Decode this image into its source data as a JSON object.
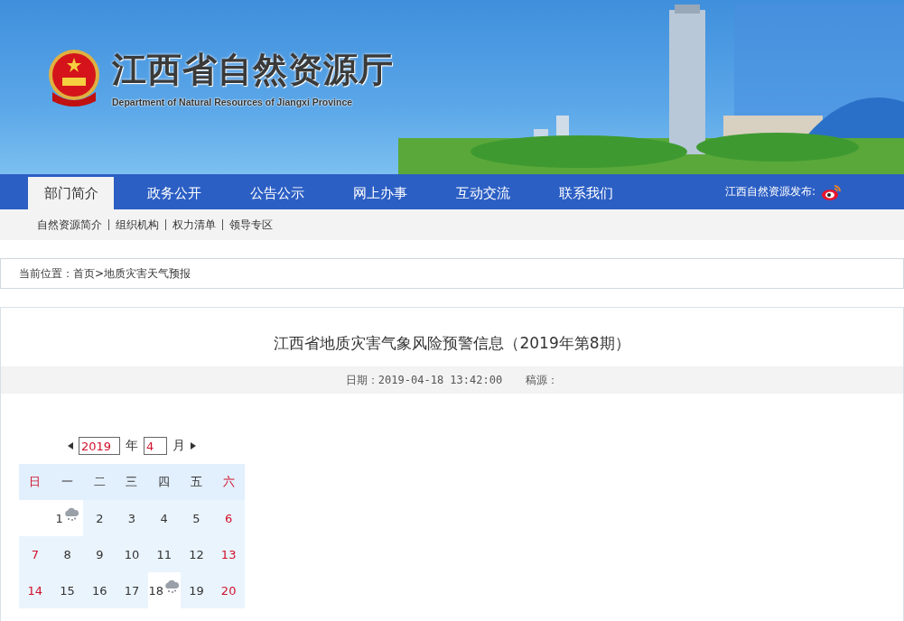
{
  "header": {
    "title": "江西省自然资源厅",
    "subtitle": "Department of Natural Resources of Jiangxi Province"
  },
  "nav": {
    "items": [
      {
        "label": "部门简介",
        "selected": true
      },
      {
        "label": "政务公开",
        "selected": false
      },
      {
        "label": "公告公示",
        "selected": false
      },
      {
        "label": "网上办事",
        "selected": false
      },
      {
        "label": "互动交流",
        "selected": false
      },
      {
        "label": "联系我们",
        "selected": false
      }
    ],
    "release_label": "江西自然资源发布:"
  },
  "subnav": [
    "自然资源简介",
    "组织机构",
    "权力清单",
    "领导专区"
  ],
  "breadcrumb": {
    "label": "当前位置：",
    "path": "首页>地质灾害天气预报"
  },
  "article": {
    "title": "江西省地质灾害气象风险预警信息（2019年第8期）",
    "date": "日期：2019-04-18 13:42:00",
    "source": "稿源："
  },
  "calendar": {
    "year": "2019",
    "year_label": "年",
    "month": "4",
    "month_label": "月",
    "weekdays": [
      {
        "label": "日",
        "weekend": true
      },
      {
        "label": "一",
        "weekend": false
      },
      {
        "label": "二",
        "weekend": false
      },
      {
        "label": "三",
        "weekend": false
      },
      {
        "label": "四",
        "weekend": false
      },
      {
        "label": "五",
        "weekend": false
      },
      {
        "label": "六",
        "weekend": true
      }
    ],
    "weeks": [
      [
        {
          "kind": "empty"
        },
        {
          "kind": "day",
          "day": "1",
          "weekend": false,
          "warning": true
        },
        {
          "kind": "day",
          "day": "2",
          "weekend": false,
          "warning": false
        },
        {
          "kind": "day",
          "day": "3",
          "weekend": false,
          "warning": false
        },
        {
          "kind": "day",
          "day": "4",
          "weekend": false,
          "warning": false
        },
        {
          "kind": "day",
          "day": "5",
          "weekend": false,
          "warning": false
        },
        {
          "kind": "day",
          "day": "6",
          "weekend": true,
          "warning": false
        }
      ],
      [
        {
          "kind": "day",
          "day": "7",
          "weekend": true,
          "warning": false
        },
        {
          "kind": "day",
          "day": "8",
          "weekend": false,
          "warning": false
        },
        {
          "kind": "day",
          "day": "9",
          "weekend": false,
          "warning": false
        },
        {
          "kind": "day",
          "day": "10",
          "weekend": false,
          "warning": false
        },
        {
          "kind": "day",
          "day": "11",
          "weekend": false,
          "warning": false
        },
        {
          "kind": "day",
          "day": "12",
          "weekend": false,
          "warning": false
        },
        {
          "kind": "day",
          "day": "13",
          "weekend": true,
          "warning": false
        }
      ],
      [
        {
          "kind": "day",
          "day": "14",
          "weekend": true,
          "warning": false
        },
        {
          "kind": "day",
          "day": "15",
          "weekend": false,
          "warning": false
        },
        {
          "kind": "day",
          "day": "16",
          "weekend": false,
          "warning": false
        },
        {
          "kind": "day",
          "day": "17",
          "weekend": false,
          "warning": false
        },
        {
          "kind": "day",
          "day": "18",
          "weekend": false,
          "warning": true
        },
        {
          "kind": "day",
          "day": "19",
          "weekend": false,
          "warning": false
        },
        {
          "kind": "day",
          "day": "20",
          "weekend": true,
          "warning": false
        }
      ]
    ]
  }
}
